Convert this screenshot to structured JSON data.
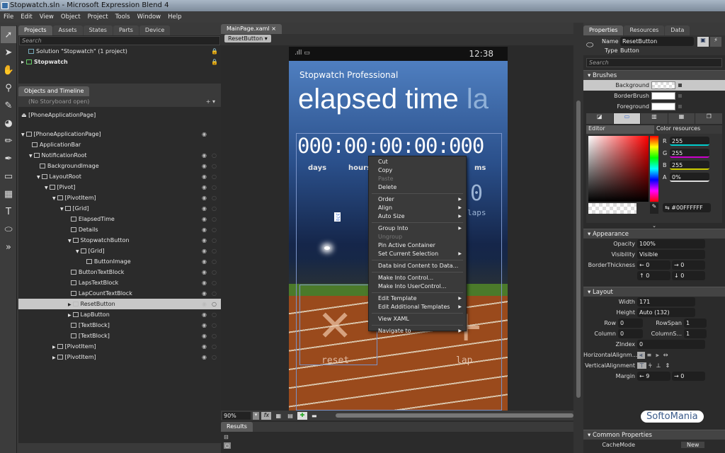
{
  "window": {
    "title": "Stopwatch.sln - Microsoft Expression Blend 4"
  },
  "menu": [
    "File",
    "Edit",
    "View",
    "Object",
    "Project",
    "Tools",
    "Window",
    "Help"
  ],
  "projects_panel": {
    "tabs": [
      "Projects",
      "Assets",
      "States",
      "Parts",
      "Device"
    ],
    "search_placeholder": "Search",
    "solution": "Solution \"Stopwatch\" (1 project)",
    "project": "Stopwatch"
  },
  "objects_panel": {
    "title": "Objects and Timeline",
    "storyboard": "(No Storyboard open)",
    "root": "[PhoneApplicationPage]",
    "tree": [
      {
        "label": "[PhoneApplicationPage]",
        "depth": 0,
        "exp": "▼",
        "eye": false
      },
      {
        "label": "ApplicationBar",
        "depth": 1,
        "exp": "",
        "eye": false
      },
      {
        "label": "NotificationRoot",
        "depth": 1,
        "exp": "▼",
        "eye": true
      },
      {
        "label": "BackgroundImage",
        "depth": 2,
        "exp": "",
        "eye": true
      },
      {
        "label": "LayoutRoot",
        "depth": 2,
        "exp": "▼",
        "eye": true
      },
      {
        "label": "[Pivot]",
        "depth": 3,
        "exp": "▼",
        "eye": true
      },
      {
        "label": "[PivotItem]",
        "depth": 4,
        "exp": "▼",
        "eye": true
      },
      {
        "label": "[Grid]",
        "depth": 5,
        "exp": "▼",
        "eye": true
      },
      {
        "label": "ElapsedTime",
        "depth": 6,
        "exp": "",
        "eye": true
      },
      {
        "label": "Details",
        "depth": 6,
        "exp": "",
        "eye": true
      },
      {
        "label": "StopwatchButton",
        "depth": 6,
        "exp": "▼",
        "eye": true
      },
      {
        "label": "[Grid]",
        "depth": 7,
        "exp": "▼",
        "eye": true
      },
      {
        "label": "ButtonImage",
        "depth": 8,
        "exp": "",
        "eye": true
      },
      {
        "label": "ButtonTextBlock",
        "depth": 6,
        "exp": "",
        "eye": true
      },
      {
        "label": "LapsTextBlock",
        "depth": 6,
        "exp": "",
        "eye": true
      },
      {
        "label": "LapCountTextBlock",
        "depth": 6,
        "exp": "",
        "eye": true
      },
      {
        "label": "ResetButton",
        "depth": 6,
        "exp": "▶",
        "eye": true,
        "selected": true
      },
      {
        "label": "LapButton",
        "depth": 6,
        "exp": "▶",
        "eye": true
      },
      {
        "label": "[TextBlock]",
        "depth": 6,
        "exp": "",
        "eye": true
      },
      {
        "label": "[TextBlock]",
        "depth": 6,
        "exp": "",
        "eye": true
      },
      {
        "label": "[PivotItem]",
        "depth": 4,
        "exp": "▶",
        "eye": true
      },
      {
        "label": "[PivotItem]",
        "depth": 4,
        "exp": "▶",
        "eye": true
      }
    ]
  },
  "document": {
    "tab": "MainPage.xaml",
    "breadcrumb": "ResetButton",
    "zoom": "90%",
    "results_tab": "Results"
  },
  "phone": {
    "time": "12:38",
    "app_title": "Stopwatch Professional",
    "pivot_header": "elapsed time",
    "pivot_next": "la",
    "timer": "000:00:00:00:000",
    "units": [
      "days",
      "hours",
      "ms"
    ],
    "laps_count": "0",
    "laps_label": "laps",
    "reset_label": "reset",
    "lap_label": "lap",
    "margin_tag": "370"
  },
  "context_menu": [
    [
      {
        "label": "Cut"
      },
      {
        "label": "Copy"
      },
      {
        "label": "Paste",
        "disabled": true
      },
      {
        "label": "Delete"
      }
    ],
    [
      {
        "label": "Order",
        "sub": true
      },
      {
        "label": "Align",
        "sub": true
      },
      {
        "label": "Auto Size",
        "sub": true
      }
    ],
    [
      {
        "label": "Group Into",
        "sub": true
      },
      {
        "label": "Ungroup",
        "disabled": true
      },
      {
        "label": "Pin Active Container"
      },
      {
        "label": "Set Current Selection",
        "sub": true
      }
    ],
    [
      {
        "label": "Data bind Content to Data..."
      }
    ],
    [
      {
        "label": "Make Into Control..."
      },
      {
        "label": "Make Into UserControl..."
      }
    ],
    [
      {
        "label": "Edit Template",
        "sub": true
      },
      {
        "label": "Edit Additional Templates",
        "sub": true
      }
    ],
    [
      {
        "label": "View XAML"
      }
    ],
    [
      {
        "label": "Navigate to",
        "sub": true
      }
    ]
  ],
  "properties": {
    "tabs": [
      "Properties",
      "Resources",
      "Data"
    ],
    "name_label": "Name",
    "name_value": "ResetButton",
    "type_label": "Type",
    "type_value": "Button",
    "search_placeholder": "Search",
    "brushes": {
      "title": "Brushes",
      "items": [
        "Background",
        "BorderBrush",
        "Foreground"
      ],
      "editor_tab": "Editor",
      "resources_tab": "Color resources",
      "r_label": "R",
      "r": "255",
      "g_label": "G",
      "g": "255",
      "b_label": "B",
      "b": "255",
      "a_label": "A",
      "a": "0%",
      "hex": "#00FFFFFF"
    },
    "appearance": {
      "title": "Appearance",
      "opacity_label": "Opacity",
      "opacity": "100%",
      "visibility_label": "Visibility",
      "visibility": "Visible",
      "border_label": "BorderThickness",
      "border": [
        "0",
        "0",
        "0",
        "0"
      ]
    },
    "layout": {
      "title": "Layout",
      "width_label": "Width",
      "width": "171",
      "height_label": "Height",
      "height": "Auto (132)",
      "row_label": "Row",
      "row": "0",
      "rowspan_label": "RowSpan",
      "rowspan": "1",
      "column_label": "Column",
      "column": "0",
      "colspan_label": "ColumnS...",
      "colspan": "1",
      "zindex_label": "ZIndex",
      "zindex": "0",
      "halign_label": "HorizontalAlignm...",
      "valign_label": "VerticalAlignment",
      "margin_label": "Margin",
      "margin": [
        "9",
        "0"
      ]
    },
    "common": {
      "title": "Common Properties",
      "cachemode_label": "CacheMode",
      "cachemode_button": "New"
    }
  },
  "watermark": "SoftoMania",
  "colors": {
    "accent": "#3a6ea5",
    "selection": "#c8c8c8",
    "panel": "#2b2b2b"
  }
}
